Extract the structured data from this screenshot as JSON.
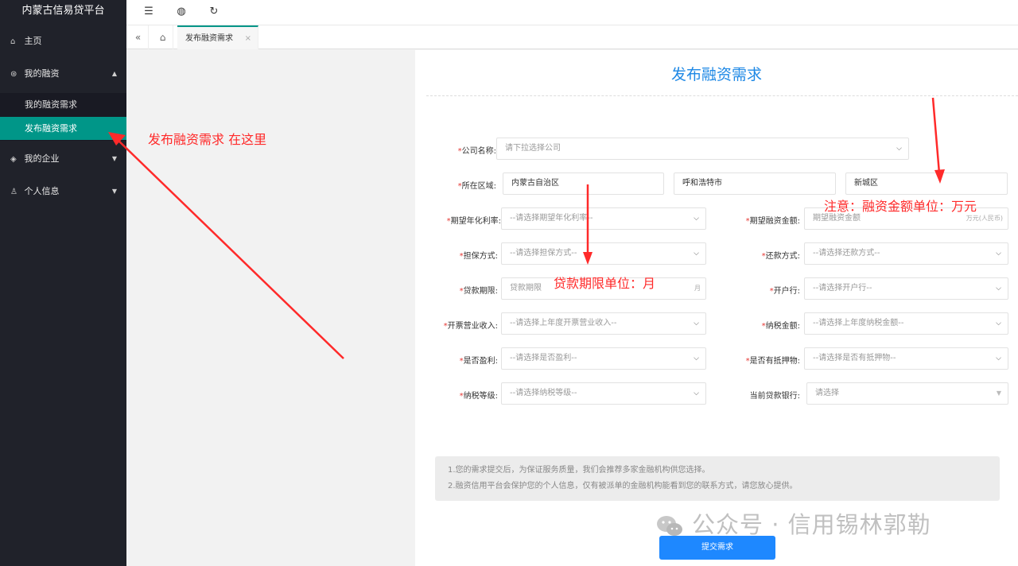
{
  "sidebar": {
    "brand": "内蒙古信易贷平台",
    "items": [
      {
        "label": "主页",
        "icon": "home-icon"
      },
      {
        "label": "我的融资",
        "icon": "yen-circle-icon"
      },
      {
        "label": "我的企业",
        "icon": "shield-icon"
      },
      {
        "label": "个人信息",
        "icon": "user-icon"
      }
    ],
    "submenu": [
      {
        "label": "我的融资需求"
      },
      {
        "label": "发布融资需求",
        "active": true
      }
    ]
  },
  "toolbar": {
    "icons": [
      "menu-fold-icon",
      "globe-icon",
      "refresh-icon"
    ]
  },
  "tabs": {
    "items": [
      {
        "label": "发布融资需求",
        "close": "×"
      }
    ]
  },
  "form": {
    "title": "发布融资需求",
    "company": {
      "label": "公司名称:",
      "placeholder": "请下拉选择公司"
    },
    "region": {
      "label": "所在区域:",
      "province": "内蒙古自治区",
      "city": "呼和浩特市",
      "district": "新城区"
    },
    "rate": {
      "label": "期望年化利率:",
      "placeholder": "--请选择期望年化利率--"
    },
    "amount": {
      "label": "期望融资金额:",
      "placeholder": "期望融资金额",
      "suffix": "万元(人民币)"
    },
    "guarantee": {
      "label": "担保方式:",
      "placeholder": "--请选择担保方式--"
    },
    "repay": {
      "label": "还款方式:",
      "placeholder": "--请选择还款方式--"
    },
    "term": {
      "label": "贷款期限:",
      "placeholder": "贷款期限",
      "suffix": "月"
    },
    "bank": {
      "label": "开户行:",
      "placeholder": "--请选择开户行--"
    },
    "revenue": {
      "label": "开票营业收入:",
      "placeholder": "--请选择上年度开票营业收入--"
    },
    "tax": {
      "label": "纳税金额:",
      "placeholder": "--请选择上年度纳税金额--"
    },
    "profit": {
      "label": "是否盈利:",
      "placeholder": "--请选择是否盈利--"
    },
    "collateral": {
      "label": "是否有抵押物:",
      "placeholder": "--请选择是否有抵押物--"
    },
    "taxlevel": {
      "label": "纳税等级:",
      "placeholder": "--请选择纳税等级--"
    },
    "curbank": {
      "label": "当前贷款银行:",
      "placeholder": "请选择"
    },
    "required_mark": "*"
  },
  "notice": {
    "line1": "1.您的需求提交后，为保证服务质量，我们会推荐多家金融机构供您选择。",
    "line2": "2.融资信用平台会保护您的个人信息，仅有被派单的金融机构能看到您的联系方式，请您放心提供。"
  },
  "submit_label": "提交需求",
  "watermark": "公众号 · 信用锡林郭勒",
  "annotations": {
    "menu": "发布融资需求 在这里",
    "amount": "注意：融资金额单位：万元",
    "term": "贷款期限单位：月"
  },
  "colors": {
    "accent": "#009688",
    "title": "#1e88e5",
    "annotation": "#ff2a2a",
    "submit": "#1e88ff"
  }
}
